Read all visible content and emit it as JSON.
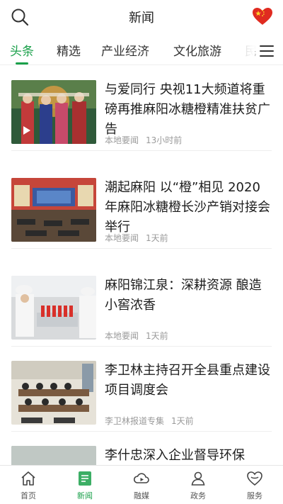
{
  "header": {
    "title": "新闻",
    "search_icon": "search-icon",
    "flag_icon": "china-flag-icon",
    "accent_color": "#1aa04a"
  },
  "tabs": [
    {
      "label": "头条",
      "active": true
    },
    {
      "label": "精选",
      "active": false
    },
    {
      "label": "产业经济",
      "active": false
    },
    {
      "label": "文化旅游",
      "active": false
    },
    {
      "label": "民",
      "active": false
    }
  ],
  "feed": [
    {
      "title": "与爱同行 央视11大频道将重磅再推麻阳冰糖橙精准扶贫广告",
      "source": "本地要闻",
      "time": "13小时前",
      "has_video": true
    },
    {
      "title": "潮起麻阳 以“橙”相见 2020年麻阳冰糖橙长沙产销对接会举行",
      "source": "本地要闻",
      "time": "1天前",
      "has_video": false
    },
    {
      "title": "麻阳锦江泉：深耕资源 酿造小窖浓香",
      "source": "本地要闻",
      "time": "1天前",
      "has_video": false
    },
    {
      "title": "李卫林主持召开全县重点建设项目调度会",
      "source": "李卫林报道专集",
      "time": "1天前",
      "has_video": false
    },
    {
      "title": "李什忠深入企业督导环保",
      "source": "",
      "time": "",
      "has_video": false
    }
  ],
  "bottom_nav": [
    {
      "label": "首页",
      "icon": "home-icon",
      "active": false
    },
    {
      "label": "新闻",
      "icon": "news-icon",
      "active": true
    },
    {
      "label": "融媒",
      "icon": "cloud-media-icon",
      "active": false
    },
    {
      "label": "政务",
      "icon": "government-icon",
      "active": false
    },
    {
      "label": "服务",
      "icon": "heart-service-icon",
      "active": false
    }
  ]
}
